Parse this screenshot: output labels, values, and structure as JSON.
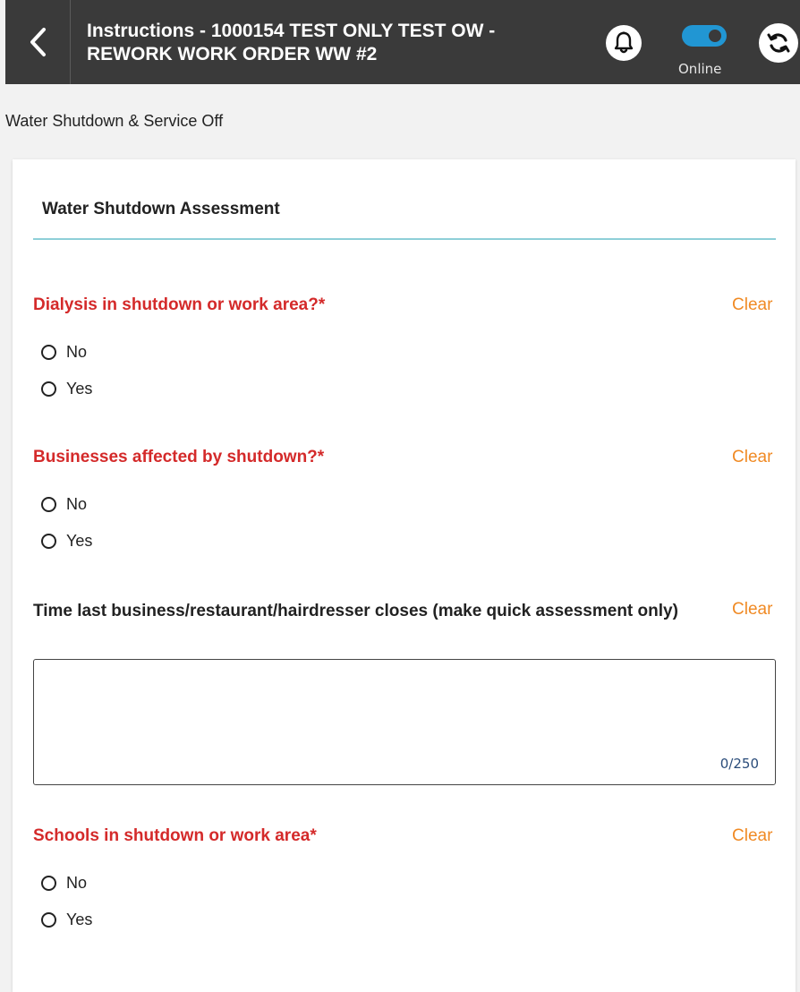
{
  "header": {
    "title_line1": "Instructions - 1000154 TEST ONLY TEST OW -",
    "title_line2": "REWORK WORK ORDER WW #2",
    "status_label": "Online",
    "status_color": "#2196d3"
  },
  "section": {
    "label": "Water Shutdown & Service Off"
  },
  "card": {
    "title": "Water Shutdown Assessment"
  },
  "questions": [
    {
      "label": "Dialysis in shutdown or work area?*",
      "clear": "Clear",
      "options": [
        "No",
        "Yes"
      ]
    },
    {
      "label": "Businesses affected by shutdown?*",
      "clear": "Clear",
      "options": [
        "No",
        "Yes"
      ]
    },
    {
      "label": "Time last business/restaurant/hairdresser closes (make quick assessment only)",
      "clear": "Clear",
      "value": "",
      "char_count": "0/250"
    },
    {
      "label": "Schools in shutdown or work area*",
      "clear": "Clear",
      "options": [
        "No",
        "Yes"
      ]
    }
  ],
  "colors": {
    "required": "#d42a2a",
    "clear": "#f08a24",
    "divider": "#8ecfd8",
    "header_bg": "#3a3a3a"
  },
  "icons": {
    "back": "chevron-left-icon",
    "notifications": "bell-icon",
    "sync": "sync-icon"
  }
}
